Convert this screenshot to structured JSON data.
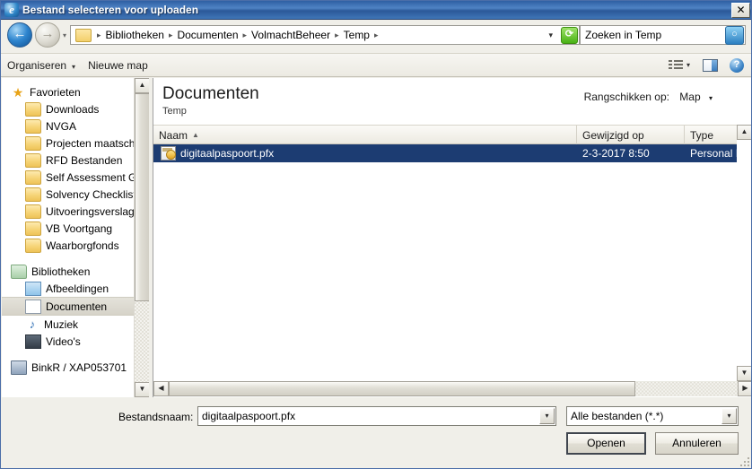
{
  "window": {
    "title": "Bestand selecteren voor uploaden",
    "app_icon": "internet-explorer-icon",
    "close_label": "✕"
  },
  "address_bar": {
    "back_arrow": "←",
    "forward_arrow": "→",
    "history_caret": "▾",
    "breadcrumbs": [
      "Bibliotheken",
      "Documenten",
      "VolmachtBeheer",
      "Temp"
    ],
    "separator": "▸",
    "dropdown_caret": "▾",
    "refresh_glyph": "⟳",
    "search_value": "Zoeken in Temp",
    "search_placeholder": "Zoeken in Temp",
    "search_icon": "🔍"
  },
  "command_bar": {
    "organize_label": "Organiseren",
    "organize_caret": "▾",
    "new_folder_label": "Nieuwe map",
    "view_caret": "▾",
    "help_glyph": "?"
  },
  "nav_pane": {
    "groups": [
      {
        "header": {
          "label": "Favorieten",
          "icon": "star-icon"
        },
        "items": [
          {
            "label": "Downloads",
            "icon": "folder-icon"
          },
          {
            "label": "NVGA",
            "icon": "folder-icon"
          },
          {
            "label": "Projecten maatschapp",
            "icon": "folder-icon"
          },
          {
            "label": "RFD Bestanden",
            "icon": "folder-icon"
          },
          {
            "label": "Self Assessment GA",
            "icon": "folder-icon"
          },
          {
            "label": "Solvency Checklist",
            "icon": "folder-icon"
          },
          {
            "label": "Uitvoeringsverslag",
            "icon": "folder-icon"
          },
          {
            "label": "VB Voortgang",
            "icon": "folder-icon"
          },
          {
            "label": "Waarborgfonds",
            "icon": "folder-icon"
          }
        ]
      },
      {
        "header": {
          "label": "Bibliotheken",
          "icon": "library-icon"
        },
        "items": [
          {
            "label": "Afbeeldingen",
            "icon": "pictures-icon"
          },
          {
            "label": "Documenten",
            "icon": "documents-icon",
            "selected": true
          },
          {
            "label": "Muziek",
            "icon": "music-icon"
          },
          {
            "label": "Video's",
            "icon": "video-icon"
          }
        ]
      },
      {
        "header": {
          "label": "BinkR / XAP053701",
          "icon": "computer-icon"
        },
        "items": []
      }
    ],
    "scroll_up": "▲",
    "scroll_down": "▼"
  },
  "file_pane": {
    "title": "Documenten",
    "subtitle": "Temp",
    "arrange_label": "Rangschikken op:",
    "arrange_value": "Map",
    "arrange_caret": "▾",
    "columns": [
      {
        "label": "Naam",
        "sort": "▲"
      },
      {
        "label": "Gewijzigd op",
        "sort": ""
      },
      {
        "label": "Type",
        "sort": ""
      }
    ],
    "rows": [
      {
        "name": "digitaalpaspoort.pfx",
        "modified": "2-3-2017 8:50",
        "type": "Personal In",
        "icon": "certificate-file-icon",
        "selected": true
      }
    ],
    "scroll_up": "▲",
    "scroll_down": "▼",
    "scroll_left": "◀",
    "scroll_right": "▶"
  },
  "bottom": {
    "filename_label": "Bestandsnaam:",
    "filename_value": "digitaalpaspoort.pfx",
    "filename_placeholder": "",
    "filetype_value": "Alle bestanden (*.*)",
    "combo_caret": "▾",
    "open_label": "Openen",
    "cancel_label": "Annuleren"
  },
  "colors": {
    "title_bar": "#2e5fa3",
    "selection": "#1c3c72",
    "chrome": "#f0efe9"
  }
}
